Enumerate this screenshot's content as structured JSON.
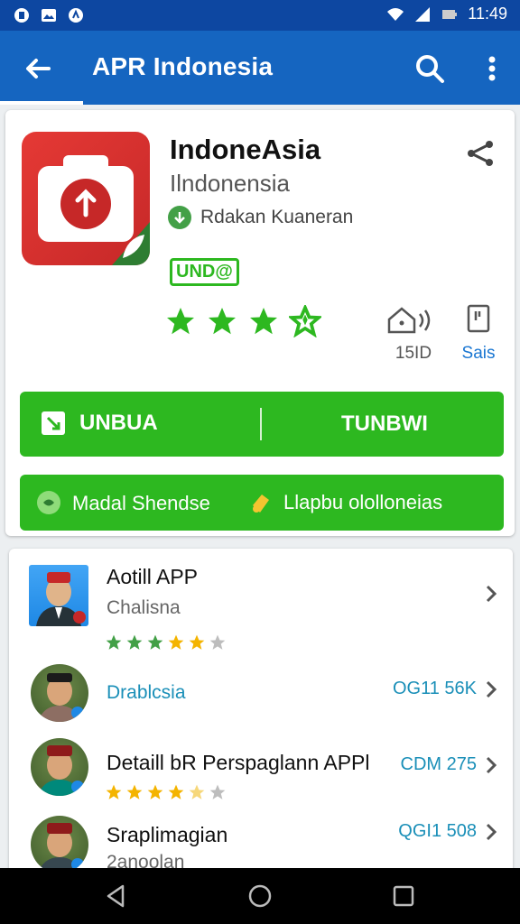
{
  "status_bar": {
    "time": "11:49"
  },
  "app_bar": {
    "title": "APR Indonesia"
  },
  "app": {
    "name": "IndoneAsia",
    "subtitle": "Ilndonensia",
    "developer": "Rdakan Kuaneran",
    "badge": "UND@",
    "rating_stars": 4,
    "stat_downloads_value": "15ID",
    "stat_save_label": "Sais"
  },
  "buttons": {
    "primary_left": "UNBUA",
    "primary_right": "TUNBWI",
    "secondary_left": "Madal Shendse",
    "secondary_right": "Llapbu ololloneias"
  },
  "list": [
    {
      "title": "Aotill APP",
      "subtitle": "Chalisna",
      "rating": 4.5,
      "price": ""
    },
    {
      "title": "",
      "subtitle": "Drablcsia",
      "rating": null,
      "price": "OG11 56K"
    },
    {
      "title": "Detaill bR Perspaglann APPl",
      "subtitle": "",
      "rating": 3.5,
      "price": "CDM 275"
    },
    {
      "title": "Sraplimagian",
      "subtitle": "2anoolan",
      "rating": null,
      "price": "QGI1 508"
    }
  ],
  "colors": {
    "status_bar": "#0d47a1",
    "app_bar": "#1565c0",
    "accent_green": "#2db820",
    "star_green": "#2db820",
    "star_gold": "#f4b400",
    "teal_text": "#1a8fb8"
  },
  "icons": [
    "back-arrow-icon",
    "search-icon",
    "more-vert-icon",
    "share-icon",
    "camera-icon",
    "download-icon",
    "save-icon",
    "home-icon",
    "recents-icon"
  ]
}
